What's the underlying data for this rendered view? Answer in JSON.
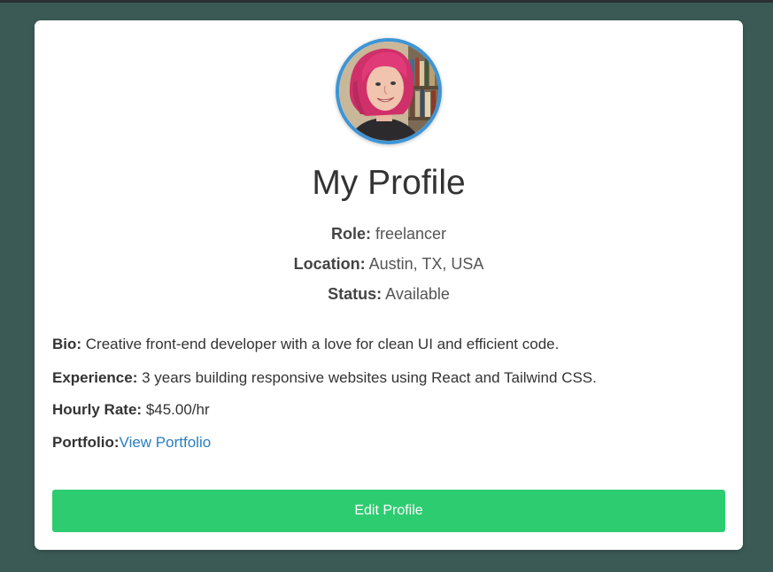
{
  "profile": {
    "title": "My Profile",
    "avatar_alt": "avatar",
    "role_label": "Role:",
    "role_value": "freelancer",
    "location_label": "Location:",
    "location_value": "Austin, TX, USA",
    "status_label": "Status:",
    "status_value": "Available",
    "bio_label": "Bio:",
    "bio_value": "Creative front-end developer with a love for clean UI and efficient code.",
    "experience_label": "Experience:",
    "experience_value": "3 years building responsive websites using React and Tailwind CSS.",
    "rate_label": "Hourly Rate:",
    "rate_value": "$45.00/hr",
    "portfolio_label": "Portfolio:",
    "portfolio_link": "View Portfolio",
    "edit_button": "Edit Profile"
  },
  "colors": {
    "page_background": "#3b5a56",
    "card_background": "#ffffff",
    "avatar_border": "#3d95d6",
    "link": "#2a7fc0",
    "button": "#2ecc71"
  }
}
